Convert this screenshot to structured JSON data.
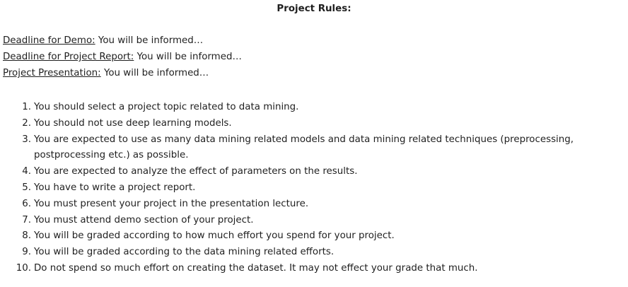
{
  "title": "Project Rules:",
  "deadlines": [
    {
      "label": "Deadline for Demo:",
      "value": " You will be informed…"
    },
    {
      "label": "Deadline for Project Report:",
      "value": " You will be informed…"
    },
    {
      "label": "Project Presentation:",
      "value": " You will be informed…"
    }
  ],
  "rules": [
    {
      "num": "1.",
      "text": "You should select a project topic related to data mining."
    },
    {
      "num": "2.",
      "text": "You should not use deep learning models."
    },
    {
      "num": "3.",
      "text": "You are expected to use as many data mining related models and data mining related techniques (preprocessing, postprocessing etc.) as possible."
    },
    {
      "num": "4.",
      "text": "You are expected to analyze the effect of parameters on the results."
    },
    {
      "num": "5.",
      "text": "You have to write a project report."
    },
    {
      "num": "6.",
      "text": "You must present your project in the presentation lecture."
    },
    {
      "num": "7.",
      "text": "You must attend demo section of your project."
    },
    {
      "num": "8.",
      "text": "You will be graded according to how much effort you spend for your project."
    },
    {
      "num": "9.",
      "text": "You will be graded according to the data mining related efforts."
    },
    {
      "num": "10.",
      "text": "Do not spend so much effort on creating the dataset. It may not effect your grade that much."
    }
  ]
}
